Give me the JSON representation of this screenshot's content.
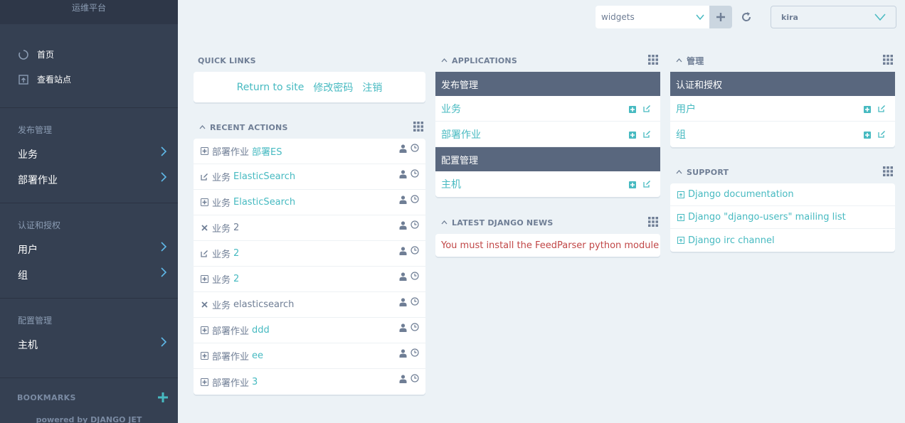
{
  "sidebar": {
    "title": "运维平台",
    "top_links": [
      {
        "label": "首页",
        "icon": "dashboard-icon"
      },
      {
        "label": "查看站点",
        "icon": "open-external-icon"
      }
    ],
    "groups": [
      {
        "title": "发布管理",
        "items": [
          {
            "label": "业务"
          },
          {
            "label": "部署作业"
          }
        ]
      },
      {
        "title": "认证和授权",
        "items": [
          {
            "label": "用户"
          },
          {
            "label": "组"
          }
        ]
      },
      {
        "title": "配置管理",
        "items": [
          {
            "label": "主机"
          }
        ]
      }
    ],
    "bookmarks_title": "BOOKMARKS",
    "powered_by": "powered by DJANGO JET"
  },
  "toolbar": {
    "widgets_select": "widgets",
    "user": "kira"
  },
  "quick_links": {
    "title": "QUICK LINKS",
    "links": [
      "Return to site",
      "修改密码",
      "注销"
    ]
  },
  "recent_actions": {
    "title": "RECENT ACTIONS",
    "rows": [
      {
        "action": "add",
        "model": "部署作业",
        "object": "部署ES",
        "linked": true
      },
      {
        "action": "change",
        "model": "业务",
        "object": "ElasticSearch",
        "linked": true
      },
      {
        "action": "add",
        "model": "业务",
        "object": "ElasticSearch",
        "linked": true
      },
      {
        "action": "delete",
        "model": "业务",
        "object": "2",
        "linked": false
      },
      {
        "action": "change",
        "model": "业务",
        "object": "2",
        "linked": true
      },
      {
        "action": "add",
        "model": "业务",
        "object": "2",
        "linked": true
      },
      {
        "action": "delete",
        "model": "业务",
        "object": "elasticsearch",
        "linked": false
      },
      {
        "action": "add",
        "model": "部署作业",
        "object": "ddd",
        "linked": true
      },
      {
        "action": "add",
        "model": "部署作业",
        "object": "ee",
        "linked": true
      },
      {
        "action": "add",
        "model": "部署作业",
        "object": "3",
        "linked": true
      }
    ]
  },
  "applications": {
    "title": "APPLICATIONS",
    "apps": [
      {
        "name": "发布管理",
        "models": [
          "业务",
          "部署作业"
        ]
      },
      {
        "name": "配置管理",
        "models": [
          "主机"
        ]
      }
    ]
  },
  "news": {
    "title": "LATEST DJANGO NEWS",
    "message": "You must install the FeedParser python module"
  },
  "auth_module": {
    "title": "管理",
    "apps": [
      {
        "name": "认证和授权",
        "models": [
          "用户",
          "组"
        ]
      }
    ]
  },
  "support": {
    "title": "SUPPORT",
    "links": [
      "Django documentation",
      "Django \"django-users\" mailing list",
      "Django irc channel"
    ]
  },
  "colors": {
    "sidebar_bg": "#354052",
    "accent": "#47bac1",
    "app_header": "#59677e",
    "error": "#c14747",
    "page_bg": "#ecf2f6"
  }
}
